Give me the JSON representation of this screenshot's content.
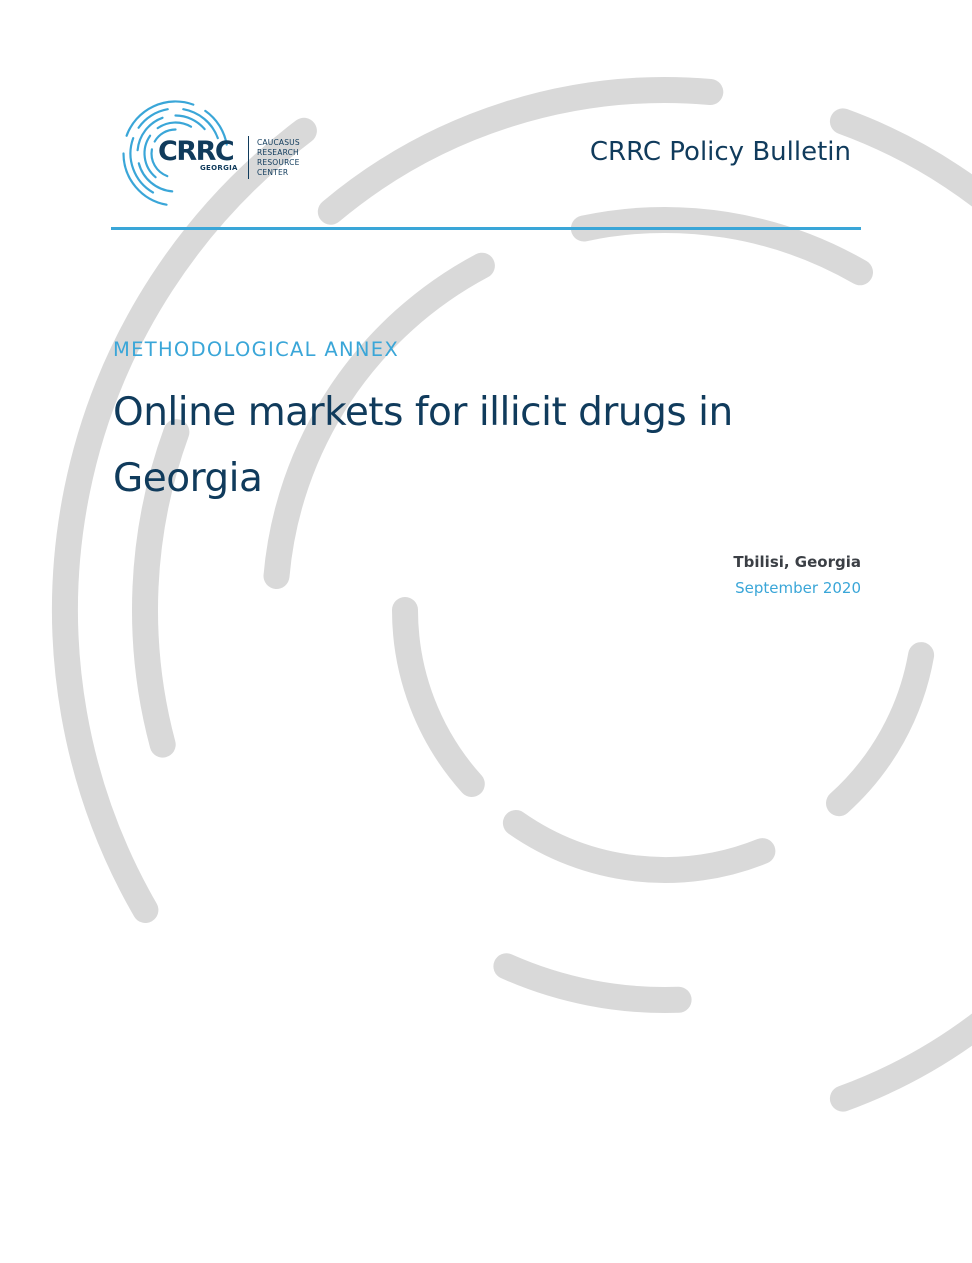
{
  "logo": {
    "mark": "CRRC",
    "sub": "GEORGIA",
    "name_lines": [
      "CAUCASUS",
      "RESEARCH",
      "RESOURCE",
      "CENTER"
    ]
  },
  "header": {
    "bulletin_label": "CRRC Policy Bulletin"
  },
  "cover": {
    "section_label": "METHODOLOGICAL ANNEX",
    "title": "Online markets for illicit drugs in Georgia",
    "location": "Tbilisi, Georgia",
    "date": "September 2020"
  },
  "colors": {
    "navy": "#103b5c",
    "accent_blue": "#3aa6d8",
    "arc_gray": "#d9d9d9"
  }
}
